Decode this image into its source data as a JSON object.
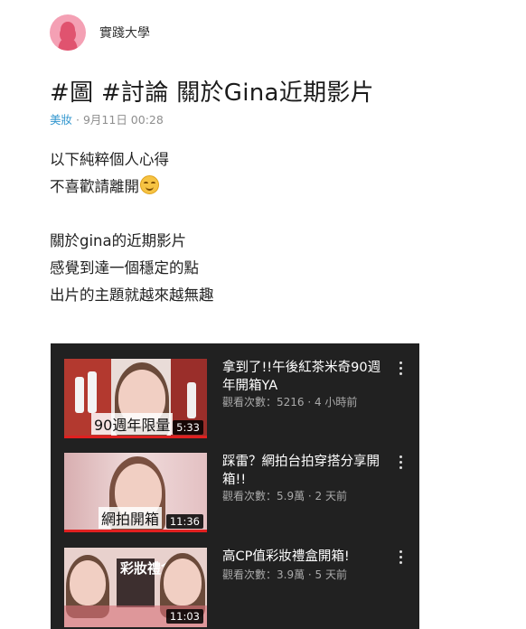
{
  "author": {
    "name": "實踐大學",
    "avatar_icon": "female-silhouette-icon"
  },
  "post": {
    "title": "#圖 #討論 關於Gina近期影片",
    "board": "美妝",
    "separator": "·",
    "date": "9月11日 00:28",
    "body_lines": [
      "以下純粹個人心得",
      "不喜歡請離開",
      "",
      "關於gina的近期影片",
      "感覺到達一個穩定的點",
      "出片的主題就越來越無趣"
    ],
    "emoji": "smiling-face-icon"
  },
  "videos": [
    {
      "title": "拿到了!!午後紅茶米奇90週年開箱YA",
      "stats": "觀看次數：5216 · 4 小時前",
      "caption": "90週年限量",
      "duration": "5:33"
    },
    {
      "title": "踩雷？網拍台拍穿搭分享開箱!!",
      "stats": "觀看次數：5.9萬 · 2 天前",
      "caption": "網拍開箱",
      "duration": "11:36"
    },
    {
      "title": "高CP值彩妝禮盒開箱!",
      "stats": "觀看次數：3.9萬 · 5 天前",
      "caption": "彩妝禮盒",
      "duration": "11:03"
    }
  ],
  "colors": {
    "accent_board": "#3397cf",
    "avatar": "#f4a0b4",
    "embed_bg": "#212121",
    "progress": "#e02020"
  }
}
